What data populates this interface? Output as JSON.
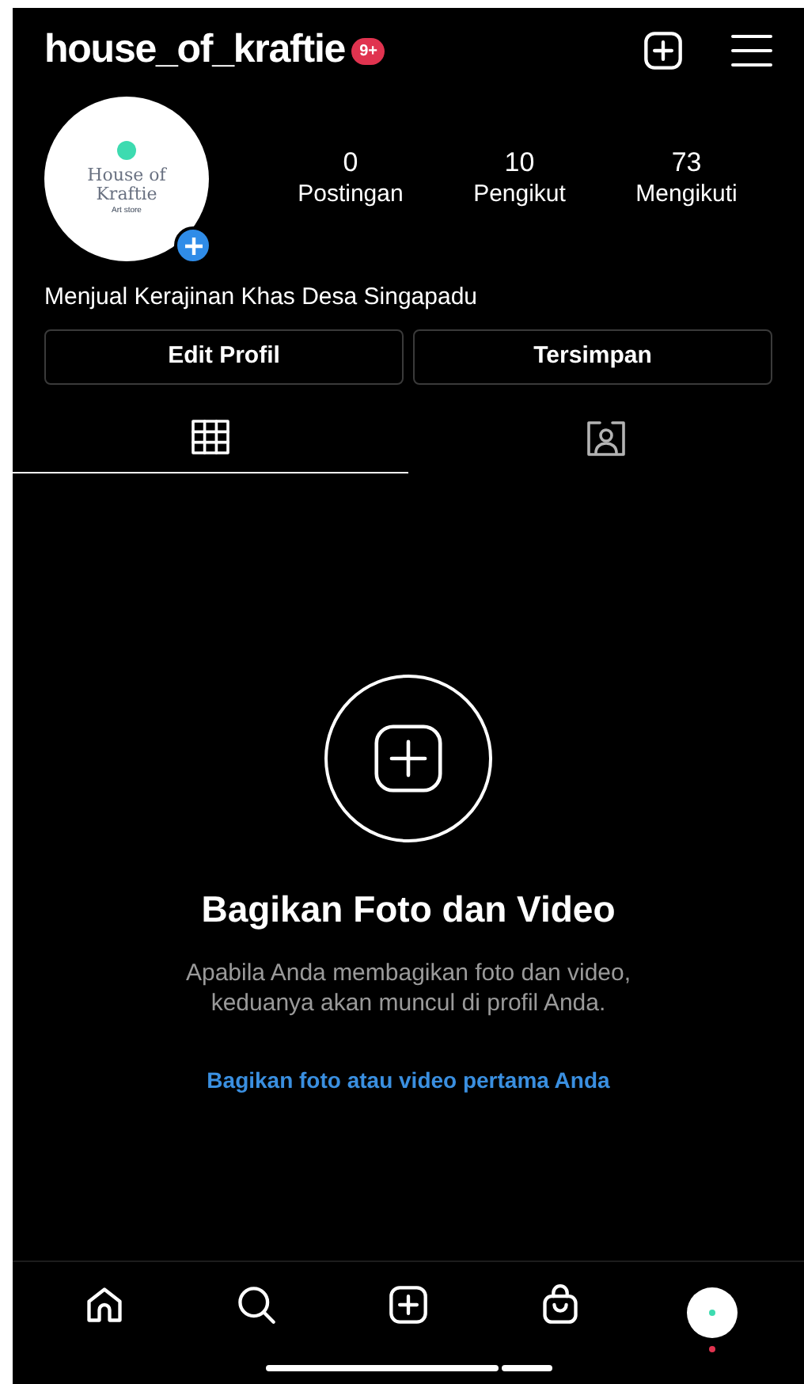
{
  "header": {
    "username": "house_of_kraftie",
    "badge": "9+"
  },
  "profile": {
    "avatar_logo": [
      "House of",
      "Kraftie",
      "Art store"
    ],
    "stats": [
      {
        "value": "0",
        "label": "Postingan"
      },
      {
        "value": "10",
        "label": "Pengikut"
      },
      {
        "value": "73",
        "label": "Mengikuti"
      }
    ],
    "bio": "Menjual Kerajinan Khas Desa Singapadu"
  },
  "buttons": [
    "Edit Profil",
    "Tersimpan"
  ],
  "tabs": [
    {
      "kind": "grid",
      "selected": true
    },
    {
      "kind": "tagged",
      "selected": false
    }
  ],
  "empty_state": {
    "title": "Bagikan Foto dan Video",
    "description": "Apabila Anda membagikan foto dan video, keduanya akan muncul di profil Anda.",
    "link": "Bagikan foto atau video pertama Anda"
  },
  "nav": [
    {
      "kind": "home"
    },
    {
      "kind": "search"
    },
    {
      "kind": "add"
    },
    {
      "kind": "shop"
    },
    {
      "kind": "profile",
      "notification": true
    }
  ]
}
